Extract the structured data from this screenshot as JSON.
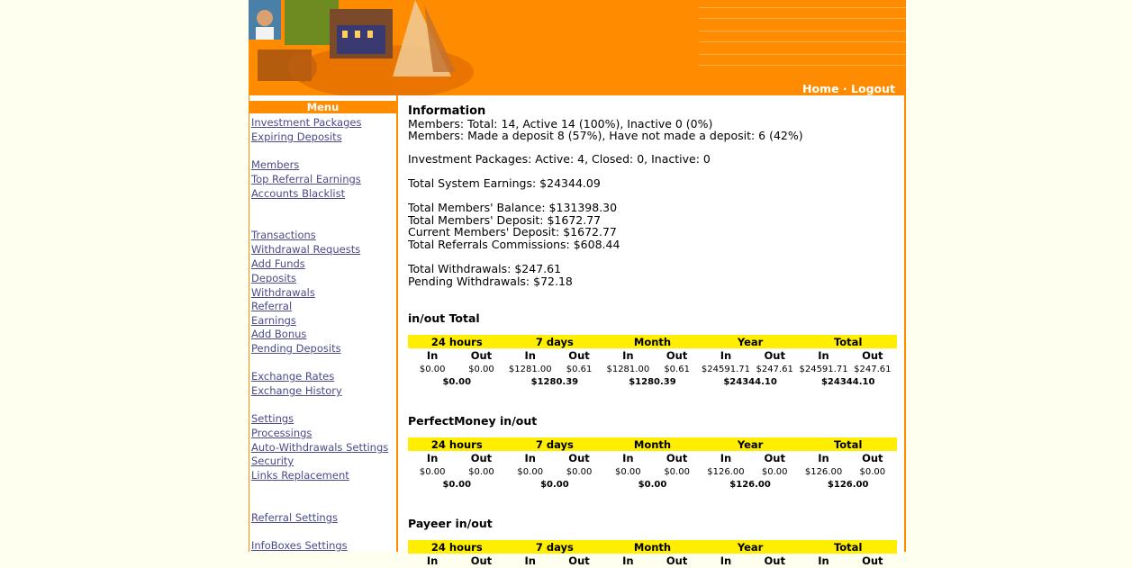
{
  "header": {
    "nav": {
      "home": "Home",
      "sep": "·",
      "logout": "Logout"
    }
  },
  "sidebar": {
    "title": "Menu",
    "items": [
      {
        "label": "Investment Packages",
        "top": 0
      },
      {
        "label": "Expiring Deposits",
        "top": 0
      },
      {
        "label": "Members",
        "top": 0
      },
      {
        "label": "Top Referral Earnings",
        "top": 0
      },
      {
        "label": "Accounts Blacklist",
        "top": 0
      },
      {
        "label": "Transactions",
        "top": 0
      },
      {
        "label": "Withdrawal Requests",
        "top": 0
      },
      {
        "label": "Add Funds",
        "top": 0
      },
      {
        "label": "Deposits",
        "top": 0
      },
      {
        "label": "Withdrawals",
        "top": 0
      },
      {
        "label": "Referral",
        "top": 0
      },
      {
        "label": "Earnings",
        "top": 0
      },
      {
        "label": "Add Bonus",
        "top": 0
      },
      {
        "label": "Pending Deposits",
        "top": 0
      },
      {
        "label": "Exchange Rates",
        "top": 0
      },
      {
        "label": "Exchange History",
        "top": 0
      },
      {
        "label": "Settings",
        "top": 0
      },
      {
        "label": "Processings",
        "top": 0
      },
      {
        "label": "Auto-Withdrawals Settings",
        "top": 0
      },
      {
        "label": "Security",
        "top": 0
      },
      {
        "label": "Links Replacement",
        "top": 0
      },
      {
        "label": "Referral Settings",
        "top": 0
      },
      {
        "label": "InfoBoxes Settings",
        "top": 0
      }
    ]
  },
  "info": {
    "title": "Information",
    "members_total": "Members: Total: 14, Active 14 (100%), Inactive 0 (0%)",
    "members_deposit": "Members: Made a deposit 8 (57%), Have not made a deposit: 6 (42%)",
    "packages": "Investment Packages: Active: 4, Closed: 0, Inactive: 0",
    "system_earnings": "Total System Earnings: $24344.09",
    "members_balance": "Total Members' Balance: $131398.30",
    "members_deposit_total": "Total Members' Deposit: $1672.77",
    "current_deposit": "Current Members' Deposit: $1672.77",
    "referral_commissions": "Total Referrals Commissions: $608.44",
    "withdrawals": "Total Withdrawals: $247.61",
    "pending_withdrawals": "Pending Withdrawals: $72.18"
  },
  "periods": [
    "24 hours",
    "7 days",
    "Month",
    "Year",
    "Total"
  ],
  "in_label": "In",
  "out_label": "Out",
  "sections": [
    {
      "title": "in/out Total",
      "values": [
        [
          "$0.00",
          "$0.00"
        ],
        [
          "$1281.00",
          "$0.61"
        ],
        [
          "$1281.00",
          "$0.61"
        ],
        [
          "$24591.71",
          "$247.61"
        ],
        [
          "$24591.71",
          "$247.61"
        ]
      ],
      "totals": [
        "$0.00",
        "$1280.39",
        "$1280.39",
        "$24344.10",
        "$24344.10"
      ]
    },
    {
      "title": "PerfectMoney in/out",
      "values": [
        [
          "$0.00",
          "$0.00"
        ],
        [
          "$0.00",
          "$0.00"
        ],
        [
          "$0.00",
          "$0.00"
        ],
        [
          "$126.00",
          "$0.00"
        ],
        [
          "$126.00",
          "$0.00"
        ]
      ],
      "totals": [
        "$0.00",
        "$0.00",
        "$0.00",
        "$126.00",
        "$126.00"
      ]
    },
    {
      "title": "Payeer in/out",
      "values": [],
      "totals": []
    }
  ]
}
